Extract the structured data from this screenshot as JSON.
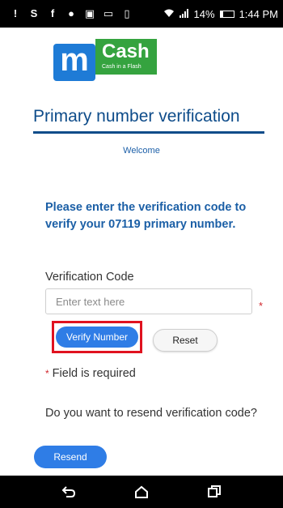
{
  "status_bar": {
    "signal_percent": "14%",
    "time": "1:44 PM"
  },
  "logo": {
    "m_letter": "m",
    "cash_text": "Cash",
    "tagline": "Cash in a Flash"
  },
  "page": {
    "title": "Primary number verification",
    "welcome": "Welcome",
    "instructions": "Please enter the verification code to verify your 07119            primary number."
  },
  "form": {
    "field_label": "Verification Code",
    "input_value": "",
    "input_placeholder": "Enter text here",
    "required_star": "*",
    "verify_label": "Verify Number",
    "reset_label": "Reset",
    "required_note": "Field is required"
  },
  "resend": {
    "question": "Do you want to resend verification code?",
    "button_label": "Resend"
  },
  "colors": {
    "title_blue": "#0e4c8a",
    "button_blue": "#2f7de6",
    "highlight_red": "#e0121f",
    "logo_blue": "#1e7bd6",
    "logo_green": "#35a33f"
  },
  "icons": [
    "alert-icon",
    "skype-icon",
    "facebook-icon",
    "messenger-icon",
    "calendar-icon",
    "cast-icon",
    "vibrate-icon",
    "wifi-icon",
    "signal-icon",
    "battery-icon",
    "back-icon",
    "home-icon",
    "recents-icon"
  ]
}
